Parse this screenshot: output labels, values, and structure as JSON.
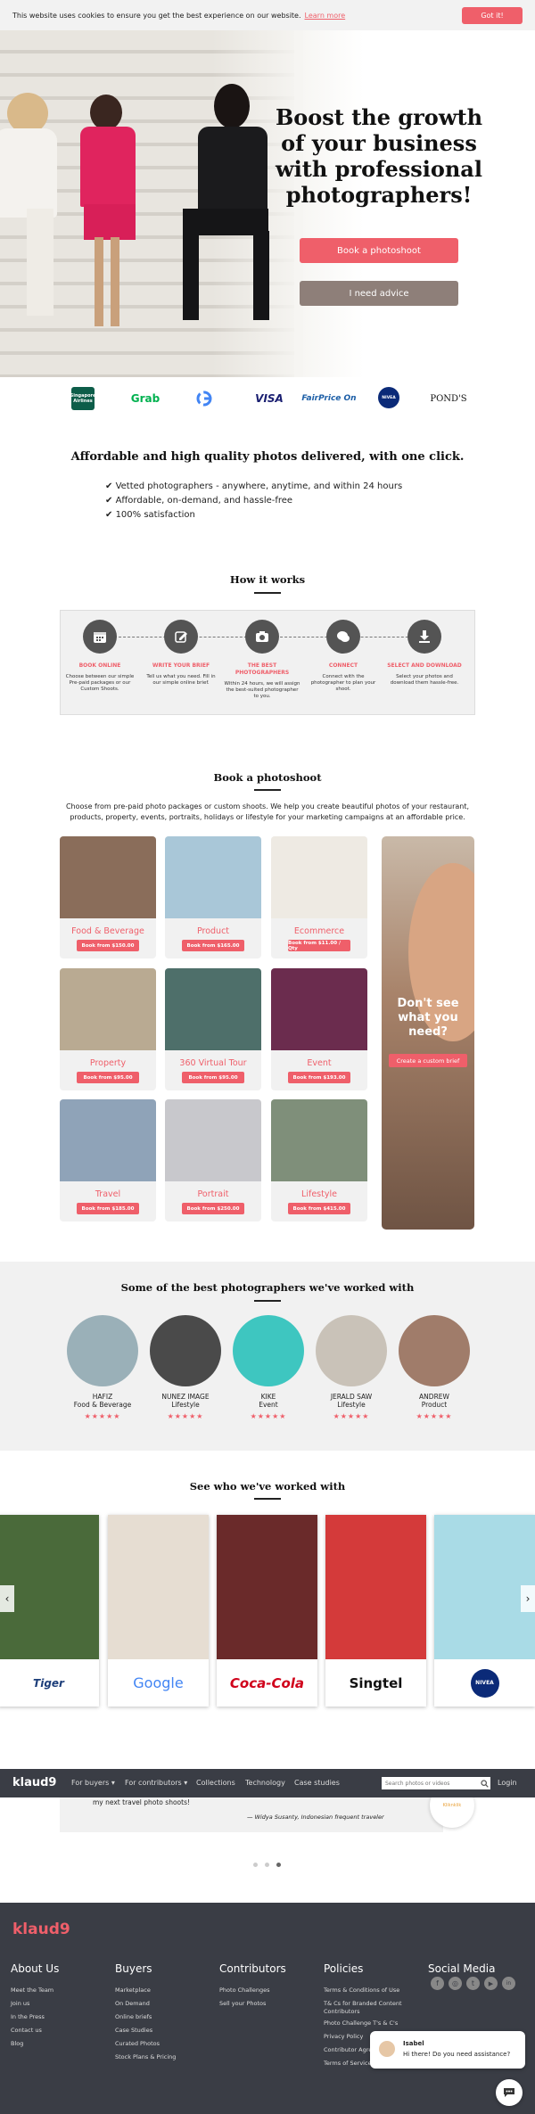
{
  "cookie": {
    "text": "This website uses cookies to ensure you get the best experience on our website.",
    "learn_more": "Learn more",
    "got_it": "Got it!"
  },
  "hero": {
    "title": "Boost the growth of your business with professional photographers!",
    "book_btn": "Book a photoshoot",
    "advice_btn": "I need advice"
  },
  "clients": [
    "Singapore Airlines",
    "Grab",
    "Google",
    "VISA",
    "FairPrice On",
    "NIVEA",
    "POND'S"
  ],
  "value": {
    "title": "Affordable and high quality photos delivered, with one click.",
    "bullets": [
      "Vetted photographers - anywhere, anytime, and within 24 hours",
      "Affordable, on-demand, and hassle-free",
      "100% satisfaction"
    ]
  },
  "how": {
    "title": "How it works",
    "steps": [
      {
        "title": "BOOK ONLINE",
        "desc": "Choose between our simple Pre-paid packages or our Custom Shoots.",
        "icon": "calendar-icon"
      },
      {
        "title": "WRITE YOUR BRIEF",
        "desc": "Tell us what you need. Fill in our simple online brief.",
        "icon": "pencil-icon"
      },
      {
        "title": "THE BEST PHOTOGRAPHERS",
        "desc": "Within 24 hours, we will assign the best-suited photographer to you.",
        "icon": "camera-icon"
      },
      {
        "title": "CONNECT",
        "desc": "Connect with the photographer to plan your shoot.",
        "icon": "chat-icon"
      },
      {
        "title": "SELECT AND DOWNLOAD",
        "desc": "Select your photos and download them hassle-free.",
        "icon": "download-icon"
      }
    ]
  },
  "book": {
    "title": "Book a photoshoot",
    "intro": "Choose from pre-paid photo packages or custom shoots. We help you create beautiful photos of your restaurant, products, property, events, portraits, holidays or lifestyle for your marketing campaigns at an affordable price.",
    "packages": [
      {
        "label": "Food & Beverage",
        "price": "Book from $150.00",
        "color": "#8a6d5a"
      },
      {
        "label": "Product",
        "price": "Book from $165.00",
        "color": "#a9c7d8"
      },
      {
        "label": "Ecommerce",
        "price": "Book from $11.00 / Qty",
        "color": "#eeeae3"
      },
      {
        "label": "Property",
        "price": "Book from $95.00",
        "color": "#b9aa92"
      },
      {
        "label": "360 Virtual Tour",
        "price": "Book from $95.00",
        "color": "#4e6f6a"
      },
      {
        "label": "Event",
        "price": "Book from $193.00",
        "color": "#6b2c4e"
      },
      {
        "label": "Travel",
        "price": "Book from $185.00",
        "color": "#8fa3b8"
      },
      {
        "label": "Portrait",
        "price": "Book from $250.00",
        "color": "#c8c8cc"
      },
      {
        "label": "Lifestyle",
        "price": "Book from $415.00",
        "color": "#7f8f7a"
      }
    ],
    "custom": {
      "title": "Don't see what you need?",
      "button": "Create a custom brief"
    }
  },
  "photographers": {
    "title": "Some of the best photographers we've worked with",
    "list": [
      {
        "name": "HAFIZ",
        "specialty": "Food & Beverage",
        "stars": "★★★★★",
        "color": "#9ab0b8"
      },
      {
        "name": "NUNEZ IMAGE",
        "specialty": "Lifestyle",
        "stars": "★★★★★",
        "color": "#4a4a4a"
      },
      {
        "name": "KIKE",
        "specialty": "Event",
        "stars": "★★★★★",
        "color": "#3ec6c0"
      },
      {
        "name": "JERALD SAW",
        "specialty": "Lifestyle",
        "stars": "★★★★★",
        "color": "#c9c2b8"
      },
      {
        "name": "ANDREW",
        "specialty": "Product",
        "stars": "★★★★★",
        "color": "#a07c6a"
      }
    ]
  },
  "worked": {
    "title": "See who we've worked with",
    "brands": [
      {
        "name": "Tiger",
        "color": "#4a6a3a"
      },
      {
        "name": "Google",
        "color": "#e6ddd2"
      },
      {
        "name": "Coca-Cola",
        "color": "#6a2a2a"
      },
      {
        "name": "Singtel",
        "color": "#d43a3a"
      },
      {
        "name": "NIVEA",
        "color": "#a9dbe6"
      }
    ]
  },
  "nav": {
    "logo": "klaud9",
    "items": [
      "For buyers ▾",
      "For contributors ▾",
      "Collections",
      "Technology",
      "Case studies"
    ],
    "search_placeholder": "Search photos or videos",
    "login": "Login"
  },
  "testimonial": {
    "text": "my next travel photo shoots!",
    "author": "— Widya Susanty, Indonesian frequent traveler",
    "brand": "Kliknklik"
  },
  "footer": {
    "logo": "klaud9",
    "columns": [
      {
        "title": "About Us",
        "links": [
          "Meet the Team",
          "Join us",
          "In the Press",
          "Contact us",
          "Blog"
        ]
      },
      {
        "title": "Buyers",
        "links": [
          "Marketplace",
          "On Demand",
          "Online briefs",
          "Case Studies",
          "Curated Photos",
          "Stock Plans & Pricing"
        ]
      },
      {
        "title": "Contributors",
        "links": [
          "Photo Challenges",
          "Sell your Photos"
        ]
      },
      {
        "title": "Policies",
        "links": [
          "Terms & Conditions of Use",
          "T& Cs for Branded Content Contributors",
          "Photo Challenge T's & C's",
          "Privacy Policy",
          "Contributor Agreement",
          "Terms of Service"
        ]
      },
      {
        "title": "Social Media",
        "links": []
      }
    ]
  },
  "chat": {
    "name": "Isabel",
    "message": "Hi there! Do you need assistance?"
  }
}
